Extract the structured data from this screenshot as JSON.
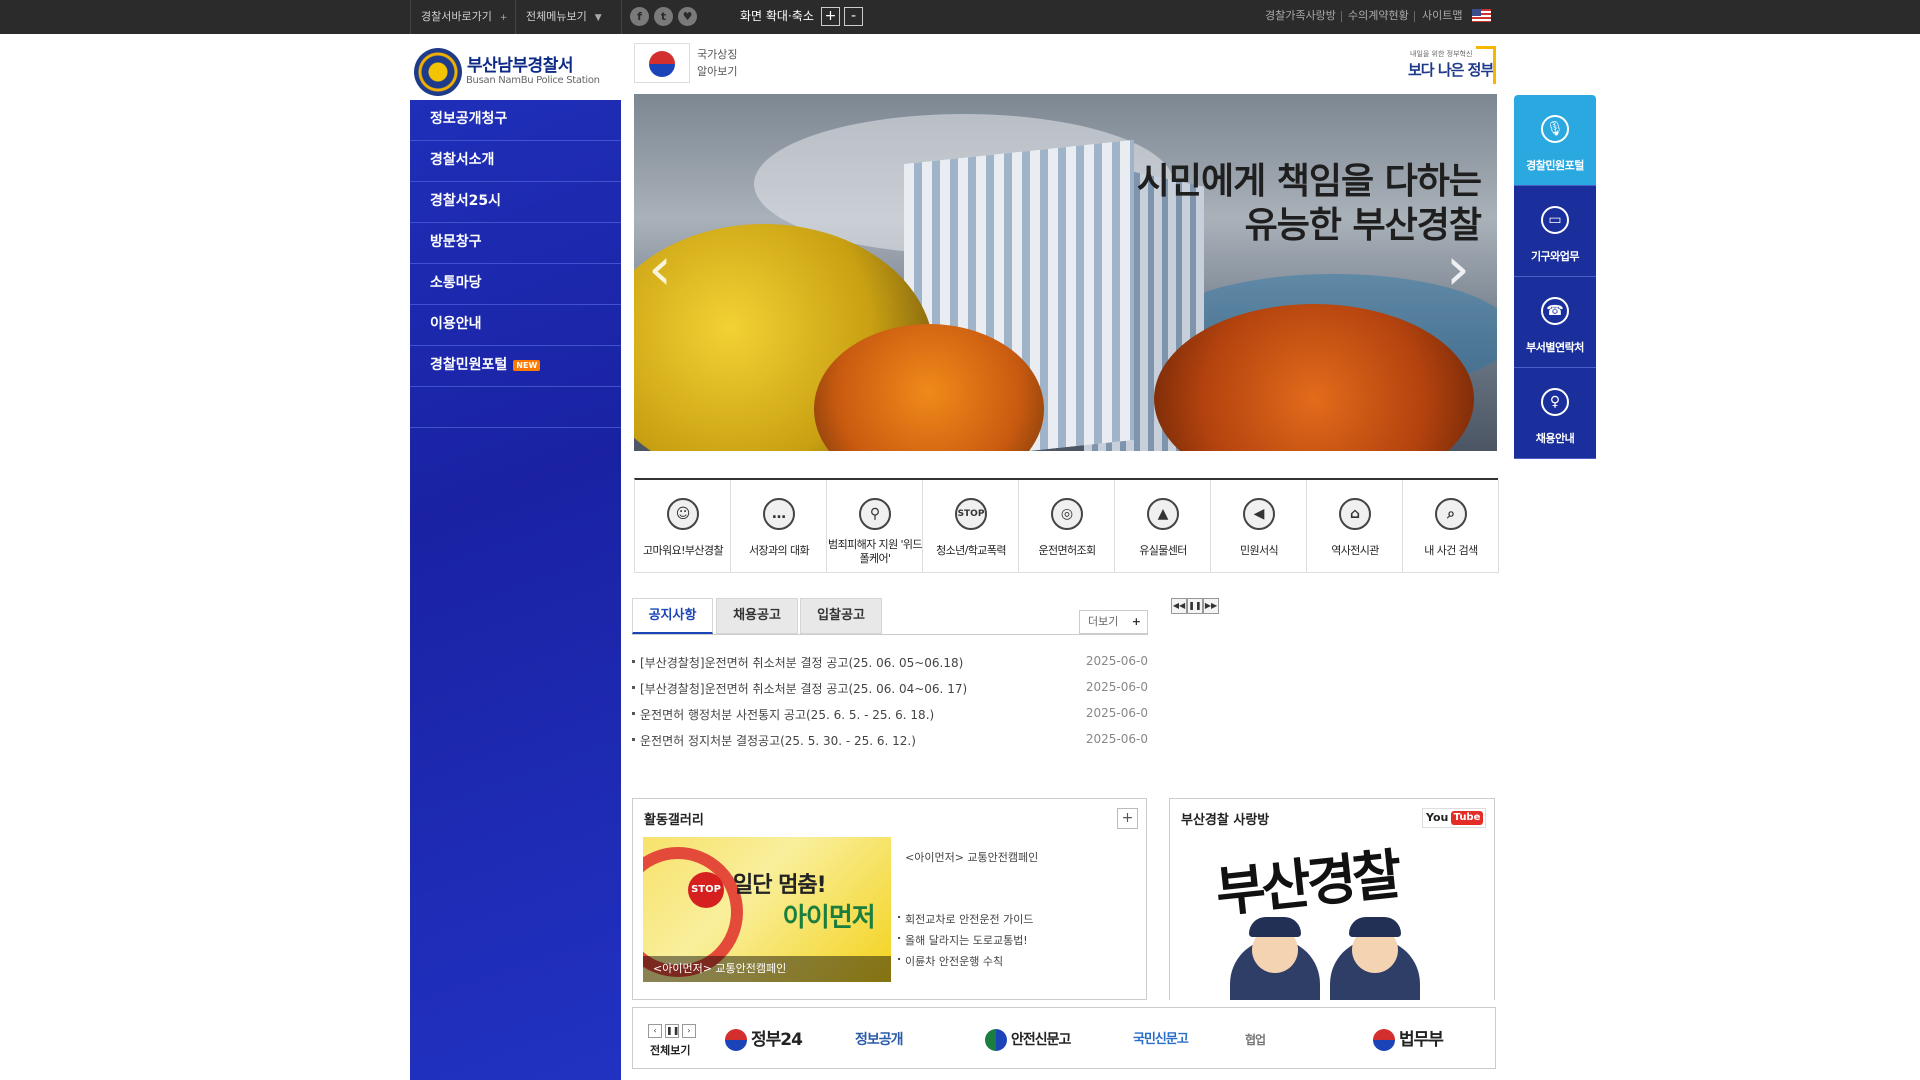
{
  "topbar": {
    "dropdown1": "경찰서바로가기",
    "dropdown2": "전체메뉴보기",
    "sns": [
      "f",
      "t",
      "♥"
    ],
    "zoom_label": "화면 확대·축소",
    "zoom_in": "+",
    "zoom_out": "-",
    "util_links": [
      "경찰가족사랑방",
      "수의계약현황",
      "사이트맵"
    ]
  },
  "header": {
    "logo_name": "부산남부경찰서",
    "logo_sub": "Busan NamBu Police Station",
    "symbol_line1": "국가상징",
    "symbol_line2": "알아보기",
    "gov_small": "내일을 위한 정부혁신",
    "gov_big": "보다 나은 정부"
  },
  "sidebar": {
    "items": [
      {
        "label": "정보공개청구"
      },
      {
        "label": "경찰서소개"
      },
      {
        "label": "경찰서25시"
      },
      {
        "label": "방문창구"
      },
      {
        "label": "소통마당"
      },
      {
        "label": "이용안내"
      },
      {
        "label": "경찰민원포털",
        "badge": "NEW"
      }
    ]
  },
  "banner": {
    "line1": "시민에게 책임을 다하는",
    "line2": "유능한 부산경찰",
    "prev": "‹",
    "next": "›"
  },
  "quick_menu": [
    {
      "label": "경찰민원포털",
      "icon": "🎙"
    },
    {
      "label": "기구와업무",
      "icon": "▭"
    },
    {
      "label": "부서별연락처",
      "icon": "☎"
    },
    {
      "label": "채용안내",
      "icon": "♀"
    }
  ],
  "shortcuts": [
    {
      "label": "고마워요!부산경찰",
      "icon": "☺"
    },
    {
      "label": "서장과의 대화",
      "icon": "…"
    },
    {
      "label": "범죄피해자 지원 '위드폴케어'",
      "icon": "⚲"
    },
    {
      "label": "청소년/학교폭력",
      "icon": "STOP"
    },
    {
      "label": "운전면허조회",
      "icon": "◎"
    },
    {
      "label": "유실물센터",
      "icon": "▲"
    },
    {
      "label": "민원서식",
      "icon": "◀"
    },
    {
      "label": "역사전시관",
      "icon": "⌂"
    },
    {
      "label": "내 사건 검색",
      "icon": "⌕"
    }
  ],
  "notice": {
    "tabs": [
      "공지사항",
      "채용공고",
      "입찰공고"
    ],
    "more": "더보기",
    "more_plus": "+",
    "items": [
      {
        "title": "[부산경찰청]운전면허 취소처분 결정 공고(25. 06. 05~06.18)",
        "date": "2025-06-0"
      },
      {
        "title": "[부산경찰청]운전면허 취소처분 결정 공고(25. 06. 04~06. 17)",
        "date": "2025-06-0"
      },
      {
        "title": "운전면허 행정처분 사전통지 공고(25. 6. 5. - 25. 6. 18.)",
        "date": "2025-06-0"
      },
      {
        "title": "운전면허 정지처분 결정공고(25. 5. 30. - 25. 6. 12.)",
        "date": "2025-06-0"
      }
    ],
    "controls": [
      "◀◀",
      "❚❚",
      "▶▶"
    ]
  },
  "gallery": {
    "title": "활동갤러리",
    "plus": "+",
    "image_text1": "일단 멈춤!",
    "image_text2": "아이먼저",
    "stop": "STOP",
    "caption": "<아이먼저> 교통안전캠페인",
    "main_title": "<아이먼저> 교통안전캠페인",
    "list": [
      "회전교차로 안전운전 가이드",
      "올해 달라지는 도로교통법!",
      "이륜차 안전운행 수칙"
    ]
  },
  "youtube": {
    "title": "부산경찰 사랑방",
    "you": "You",
    "tube": "Tube",
    "calligraphy": "부산경찰"
  },
  "links_bar": {
    "controls": [
      "‹",
      "❚❚",
      "›"
    ],
    "all": "전체보기",
    "partners": [
      "정부24",
      "정보공개",
      "안전신문고",
      "국민신문고",
      "협업",
      "법무부"
    ]
  }
}
